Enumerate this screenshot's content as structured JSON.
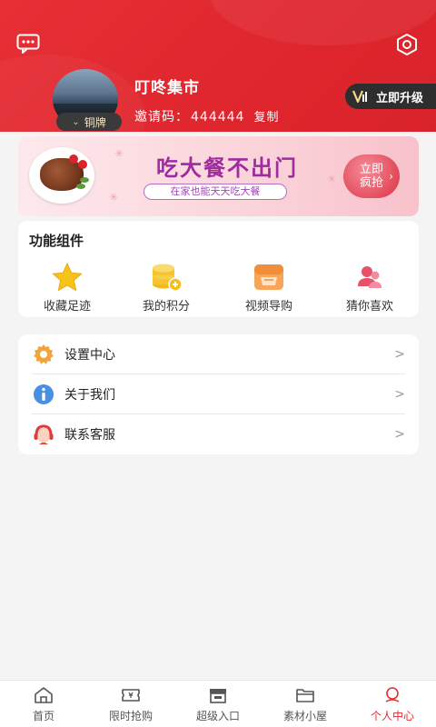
{
  "header": {
    "username": "叮咚集市",
    "invite_label": "邀请码：",
    "invite_code": "444444",
    "copy_label": "复制",
    "badge_label": "铜牌",
    "upgrade_label": "立即升级",
    "icons": {
      "message": "message-icon",
      "settings": "settings-icon",
      "vip": "vip-icon"
    }
  },
  "banner": {
    "title": "吃大餐不出门",
    "subtitle": "在家也能天天吃大餐",
    "button_line1": "立即",
    "button_line2": "疯抢",
    "button_arrow": "›"
  },
  "functions": {
    "title": "功能组件",
    "items": [
      {
        "label": "收藏足迹",
        "icon": "star-icon"
      },
      {
        "label": "我的积分",
        "icon": "coins-icon"
      },
      {
        "label": "视频导购",
        "icon": "video-store-icon"
      },
      {
        "label": "猜你喜欢",
        "icon": "users-icon"
      }
    ]
  },
  "menu": {
    "items": [
      {
        "label": "设置中心",
        "icon": "gear-icon",
        "chevron": ">"
      },
      {
        "label": "关于我们",
        "icon": "info-icon",
        "chevron": ">"
      },
      {
        "label": "联系客服",
        "icon": "support-icon",
        "chevron": ">"
      }
    ]
  },
  "tabbar": {
    "items": [
      {
        "label": "首页",
        "icon": "home-icon"
      },
      {
        "label": "限时抢购",
        "icon": "ticket-icon"
      },
      {
        "label": "超级入口",
        "icon": "store-icon"
      },
      {
        "label": "素材小屋",
        "icon": "folder-icon"
      },
      {
        "label": "个人中心",
        "icon": "profile-icon"
      }
    ],
    "active": "个人中心"
  },
  "colors": {
    "brand_red": "#e0262e",
    "banner_purple": "#a02ba0",
    "tab_active": "#e02f36"
  }
}
